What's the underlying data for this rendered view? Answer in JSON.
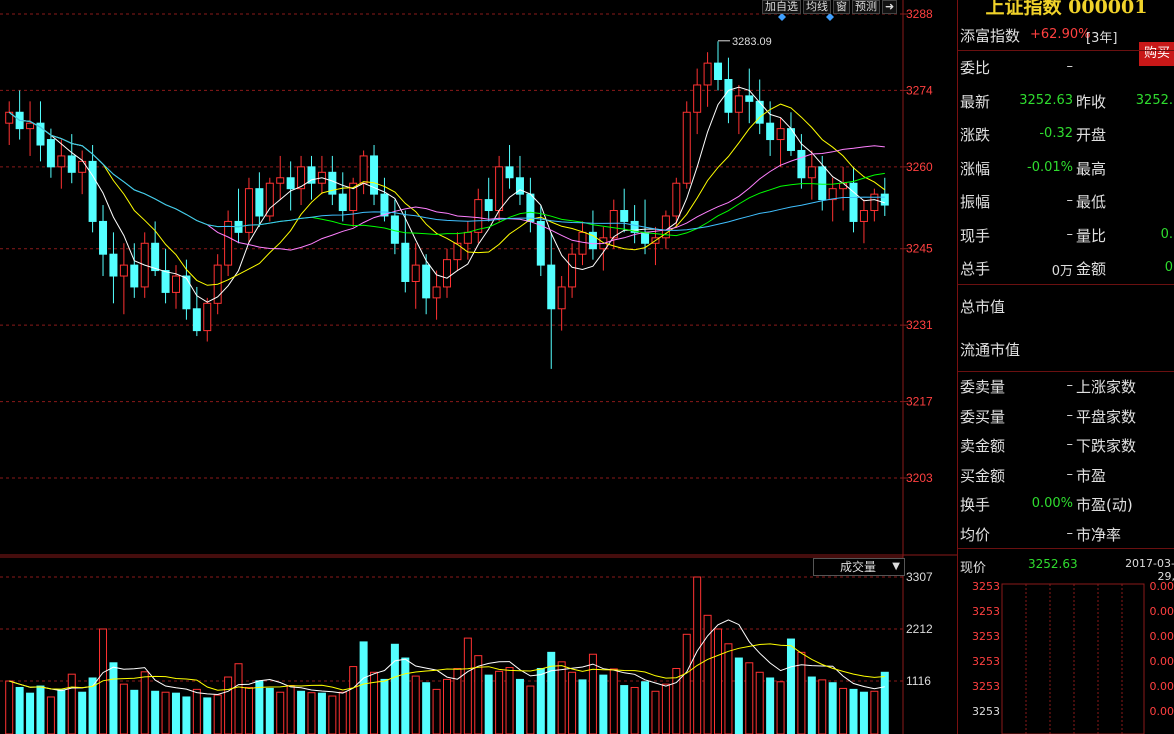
{
  "toolbar": {
    "add_watchlist": "加自选",
    "ma_line": "均线",
    "window": "窗",
    "forecast": "预测"
  },
  "price_axis": [
    "3288",
    "3274",
    "3260",
    "3245",
    "3231",
    "3217",
    "3203"
  ],
  "volume_axis": [
    "3307",
    "2212",
    "1116"
  ],
  "max_marker": "3283.09",
  "volume_label": "成交量",
  "colors": {
    "up": "#ff3232",
    "down": "#54ffff",
    "ma5": "#ffffff",
    "ma10": "#ffff00",
    "ma20": "#ff80ff",
    "ma30": "#00ff00",
    "ma60": "#40c0ff",
    "grid": "#8a1a1a",
    "accent_title": "#f0d22a"
  },
  "sidebar": {
    "title": "上证指数 000001",
    "fund_label": "添富指数",
    "fund_value": "+62.90%",
    "fund_period": "[3年]",
    "buy_button": "购买",
    "rows": [
      {
        "l1": "委比",
        "v1": "–",
        "l2": "",
        "v2": ""
      },
      {
        "l1": "最新",
        "v1": "3252.63",
        "l2": "昨收",
        "v2": "3252."
      },
      {
        "l1": "涨跌",
        "v1": "-0.32",
        "l2": "开盘",
        "v2": ""
      },
      {
        "l1": "涨幅",
        "v1": "-0.01%",
        "l2": "最高",
        "v2": ""
      },
      {
        "l1": "振幅",
        "v1": "–",
        "l2": "最低",
        "v2": ""
      },
      {
        "l1": "现手",
        "v1": "–",
        "l2": "量比",
        "v2": "0."
      },
      {
        "l1": "总手",
        "v1": "0万",
        "l2": "金额",
        "v2": "0"
      }
    ],
    "market_cap": "总市值",
    "float_cap": "流通市值",
    "rows2": [
      {
        "l1": "委卖量",
        "v1": "–",
        "l2": "上涨家数",
        "v2": ""
      },
      {
        "l1": "委买量",
        "v1": "–",
        "l2": "平盘家数",
        "v2": ""
      },
      {
        "l1": "卖金额",
        "v1": "–",
        "l2": "下跌家数",
        "v2": ""
      },
      {
        "l1": "买金额",
        "v1": "–",
        "l2": "市盈",
        "v2": ""
      },
      {
        "l1": "换手",
        "v1": "0.00%",
        "l2": "市盈(动)",
        "v2": ""
      },
      {
        "l1": "均价",
        "v1": "–",
        "l2": "市净率",
        "v2": ""
      }
    ],
    "current_label": "现价",
    "current_value": "3252.63",
    "date": "2017-03-29,",
    "ticks": [
      {
        "p": "3253",
        "c": "0.00"
      },
      {
        "p": "3253",
        "c": "0.00"
      },
      {
        "p": "3253",
        "c": "0.00"
      },
      {
        "p": "3253",
        "c": "0.00"
      },
      {
        "p": "3253",
        "c": "0.00"
      },
      {
        "p": "3253",
        "c": "0.00"
      }
    ]
  },
  "chart_data": {
    "type": "candlestick",
    "ylim": [
      3203,
      3288
    ],
    "volume_ylim": [
      0,
      3307
    ],
    "max_marker": 3283.09,
    "candles": [
      [
        3268,
        3272,
        3264,
        3270
      ],
      [
        3270,
        3274,
        3265,
        3267
      ],
      [
        3267,
        3272,
        3262,
        3268
      ],
      [
        3268,
        3272,
        3261,
        3264
      ],
      [
        3265,
        3267,
        3258,
        3260
      ],
      [
        3260,
        3265,
        3256,
        3262
      ],
      [
        3262,
        3266,
        3257,
        3259
      ],
      [
        3259,
        3263,
        3255,
        3261
      ],
      [
        3261,
        3264,
        3248,
        3250
      ],
      [
        3250,
        3253,
        3240,
        3244
      ],
      [
        3244,
        3248,
        3235,
        3240
      ],
      [
        3240,
        3246,
        3233,
        3242
      ],
      [
        3242,
        3246,
        3236,
        3238
      ],
      [
        3238,
        3248,
        3236,
        3246
      ],
      [
        3246,
        3250,
        3240,
        3241
      ],
      [
        3241,
        3245,
        3235,
        3237
      ],
      [
        3237,
        3242,
        3234,
        3240
      ],
      [
        3240,
        3243,
        3232,
        3234
      ],
      [
        3234,
        3238,
        3229,
        3230
      ],
      [
        3230,
        3236,
        3228,
        3235
      ],
      [
        3235,
        3244,
        3233,
        3242
      ],
      [
        3242,
        3252,
        3240,
        3250
      ],
      [
        3250,
        3256,
        3246,
        3248
      ],
      [
        3248,
        3258,
        3246,
        3256
      ],
      [
        3256,
        3259,
        3249,
        3251
      ],
      [
        3251,
        3258,
        3250,
        3257
      ],
      [
        3257,
        3262,
        3254,
        3258
      ],
      [
        3258,
        3261,
        3252,
        3256
      ],
      [
        3256,
        3262,
        3253,
        3260
      ],
      [
        3260,
        3262,
        3254,
        3257
      ],
      [
        3257,
        3262,
        3255,
        3259
      ],
      [
        3259,
        3262,
        3253,
        3255
      ],
      [
        3255,
        3259,
        3250,
        3252
      ],
      [
        3252,
        3258,
        3249,
        3257
      ],
      [
        3257,
        3263,
        3255,
        3262
      ],
      [
        3262,
        3264,
        3253,
        3255
      ],
      [
        3255,
        3258,
        3250,
        3251
      ],
      [
        3251,
        3254,
        3244,
        3246
      ],
      [
        3246,
        3252,
        3237,
        3239
      ],
      [
        3239,
        3246,
        3234,
        3242
      ],
      [
        3242,
        3244,
        3233,
        3236
      ],
      [
        3236,
        3241,
        3232,
        3238
      ],
      [
        3238,
        3245,
        3236,
        3243
      ],
      [
        3243,
        3248,
        3241,
        3246
      ],
      [
        3246,
        3250,
        3243,
        3248
      ],
      [
        3248,
        3256,
        3246,
        3254
      ],
      [
        3254,
        3258,
        3250,
        3252
      ],
      [
        3252,
        3262,
        3250,
        3260
      ],
      [
        3260,
        3264,
        3256,
        3258
      ],
      [
        3258,
        3262,
        3253,
        3255
      ],
      [
        3255,
        3258,
        3248,
        3250
      ],
      [
        3250,
        3253,
        3240,
        3242
      ],
      [
        3242,
        3248,
        3223,
        3234
      ],
      [
        3234,
        3240,
        3230,
        3238
      ],
      [
        3238,
        3246,
        3236,
        3244
      ],
      [
        3244,
        3250,
        3242,
        3248
      ],
      [
        3248,
        3252,
        3243,
        3245
      ],
      [
        3245,
        3249,
        3241,
        3247
      ],
      [
        3247,
        3254,
        3245,
        3252
      ],
      [
        3252,
        3256,
        3248,
        3250
      ],
      [
        3250,
        3253,
        3246,
        3248
      ],
      [
        3248,
        3254,
        3244,
        3246
      ],
      [
        3246,
        3249,
        3242,
        3247
      ],
      [
        3247,
        3252,
        3245,
        3251
      ],
      [
        3251,
        3258,
        3249,
        3257
      ],
      [
        3257,
        3272,
        3256,
        3270
      ],
      [
        3270,
        3278,
        3266,
        3275
      ],
      [
        3275,
        3281,
        3271,
        3279
      ],
      [
        3279,
        3283,
        3274,
        3276
      ],
      [
        3276,
        3280,
        3268,
        3270
      ],
      [
        3270,
        3275,
        3266,
        3273
      ],
      [
        3273,
        3278,
        3268,
        3272
      ],
      [
        3272,
        3276,
        3266,
        3268
      ],
      [
        3268,
        3272,
        3262,
        3265
      ],
      [
        3265,
        3269,
        3260,
        3267
      ],
      [
        3267,
        3270,
        3262,
        3263
      ],
      [
        3263,
        3266,
        3256,
        3258
      ],
      [
        3258,
        3263,
        3254,
        3260
      ],
      [
        3260,
        3262,
        3252,
        3254
      ],
      [
        3254,
        3258,
        3250,
        3256
      ],
      [
        3256,
        3260,
        3252,
        3257
      ],
      [
        3257,
        3260,
        3248,
        3250
      ],
      [
        3250,
        3254,
        3246,
        3252
      ],
      [
        3252,
        3256,
        3250,
        3255
      ],
      [
        3255,
        3258,
        3251,
        3253
      ]
    ],
    "volumes": [
      [
        1116,
        1
      ],
      [
        980,
        0
      ],
      [
        860,
        0
      ],
      [
        1010,
        0
      ],
      [
        780,
        1
      ],
      [
        930,
        0
      ],
      [
        1260,
        1
      ],
      [
        880,
        0
      ],
      [
        1180,
        0
      ],
      [
        2212,
        1
      ],
      [
        1500,
        0
      ],
      [
        1050,
        1
      ],
      [
        920,
        0
      ],
      [
        1310,
        1
      ],
      [
        900,
        0
      ],
      [
        880,
        1
      ],
      [
        860,
        0
      ],
      [
        780,
        0
      ],
      [
        940,
        1
      ],
      [
        760,
        0
      ],
      [
        820,
        1
      ],
      [
        1200,
        1
      ],
      [
        1480,
        1
      ],
      [
        980,
        1
      ],
      [
        1120,
        0
      ],
      [
        960,
        0
      ],
      [
        880,
        1
      ],
      [
        1020,
        1
      ],
      [
        900,
        0
      ],
      [
        870,
        1
      ],
      [
        860,
        0
      ],
      [
        800,
        1
      ],
      [
        880,
        1
      ],
      [
        1420,
        1
      ],
      [
        1940,
        0
      ],
      [
        1300,
        1
      ],
      [
        1150,
        0
      ],
      [
        1890,
        0
      ],
      [
        1600,
        0
      ],
      [
        1220,
        1
      ],
      [
        1080,
        0
      ],
      [
        940,
        1
      ],
      [
        1150,
        1
      ],
      [
        1380,
        1
      ],
      [
        2020,
        1
      ],
      [
        1650,
        1
      ],
      [
        1240,
        0
      ],
      [
        1320,
        1
      ],
      [
        1400,
        1
      ],
      [
        1150,
        0
      ],
      [
        1010,
        1
      ],
      [
        1380,
        0
      ],
      [
        1720,
        0
      ],
      [
        1520,
        1
      ],
      [
        1300,
        1
      ],
      [
        1140,
        0
      ],
      [
        1680,
        1
      ],
      [
        1240,
        0
      ],
      [
        1370,
        1
      ],
      [
        1020,
        0
      ],
      [
        980,
        1
      ],
      [
        1100,
        0
      ],
      [
        900,
        1
      ],
      [
        1050,
        1
      ],
      [
        1380,
        1
      ],
      [
        2100,
        1
      ],
      [
        3307,
        1
      ],
      [
        2500,
        1
      ],
      [
        2212,
        1
      ],
      [
        1900,
        1
      ],
      [
        1600,
        0
      ],
      [
        1500,
        1
      ],
      [
        1300,
        1
      ],
      [
        1180,
        0
      ],
      [
        1100,
        1
      ],
      [
        2000,
        0
      ],
      [
        1720,
        1
      ],
      [
        1200,
        0
      ],
      [
        1140,
        1
      ],
      [
        1080,
        0
      ],
      [
        960,
        1
      ],
      [
        940,
        0
      ],
      [
        880,
        0
      ],
      [
        900,
        1
      ],
      [
        1300,
        0
      ]
    ]
  }
}
